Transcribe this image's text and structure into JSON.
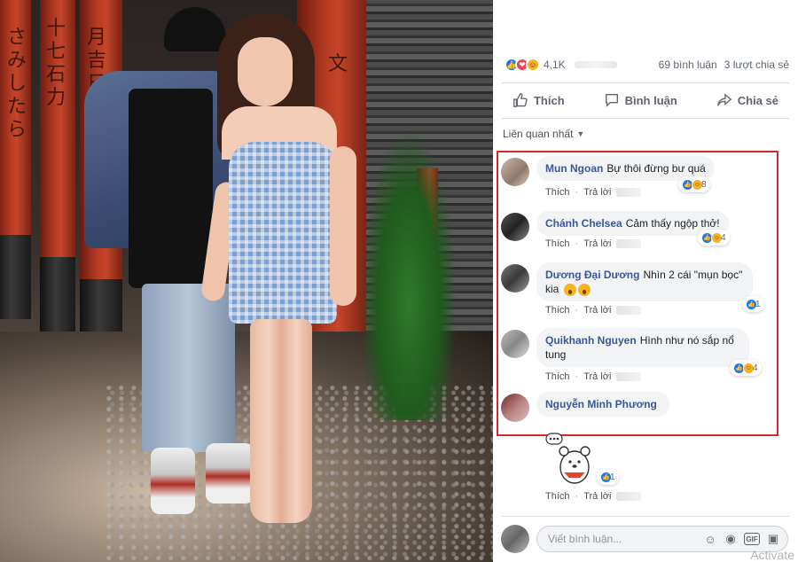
{
  "post": {
    "reactions": {
      "count": "4,1K",
      "icons": [
        "like-icon",
        "love-icon",
        "haha-icon"
      ]
    },
    "comments_count": "69 bình luận",
    "shares_count": "3 lượt chia sẻ"
  },
  "actions": {
    "like": "Thích",
    "comment": "Bình luận",
    "share": "Chia sẻ"
  },
  "sort": {
    "label": "Liên quan nhất"
  },
  "comments": [
    {
      "author": "Mun Ngoan",
      "text": "Bự thôi đừng bư quá",
      "like": "Thích",
      "reply": "Trả lời",
      "reactions": [
        "like",
        "haha"
      ],
      "reaction_count": "8"
    },
    {
      "author": "Chánh Chelsea",
      "text": "Cảm thấy ngộp thở!",
      "like": "Thích",
      "reply": "Trả lời",
      "reactions": [
        "like",
        "haha"
      ],
      "reaction_count": "4"
    },
    {
      "author": "Dương Đại Dương",
      "text": "Nhìn 2 cái \"mụn bọc\" kia",
      "like": "Thích",
      "reply": "Trả lời",
      "reactions": [
        "like"
      ],
      "reaction_count": "1"
    },
    {
      "author": "Quikhanh Nguyen",
      "text": "Hình như nó sắp nổ tung",
      "like": "Thích",
      "reply": "Trả lời",
      "reactions": [
        "like",
        "haha"
      ],
      "reaction_count": "4"
    },
    {
      "author": "Nguyễn Minh Phương",
      "text": ""
    }
  ],
  "sticker_comment": {
    "like": "Thích",
    "reply": "Trả lời",
    "reaction_count": "1"
  },
  "composer": {
    "placeholder": "Viết bình luận..."
  },
  "watermark": "Activate",
  "colors": {
    "link": "#385898",
    "like": "#1877f2",
    "highlight": "#d8282a"
  }
}
